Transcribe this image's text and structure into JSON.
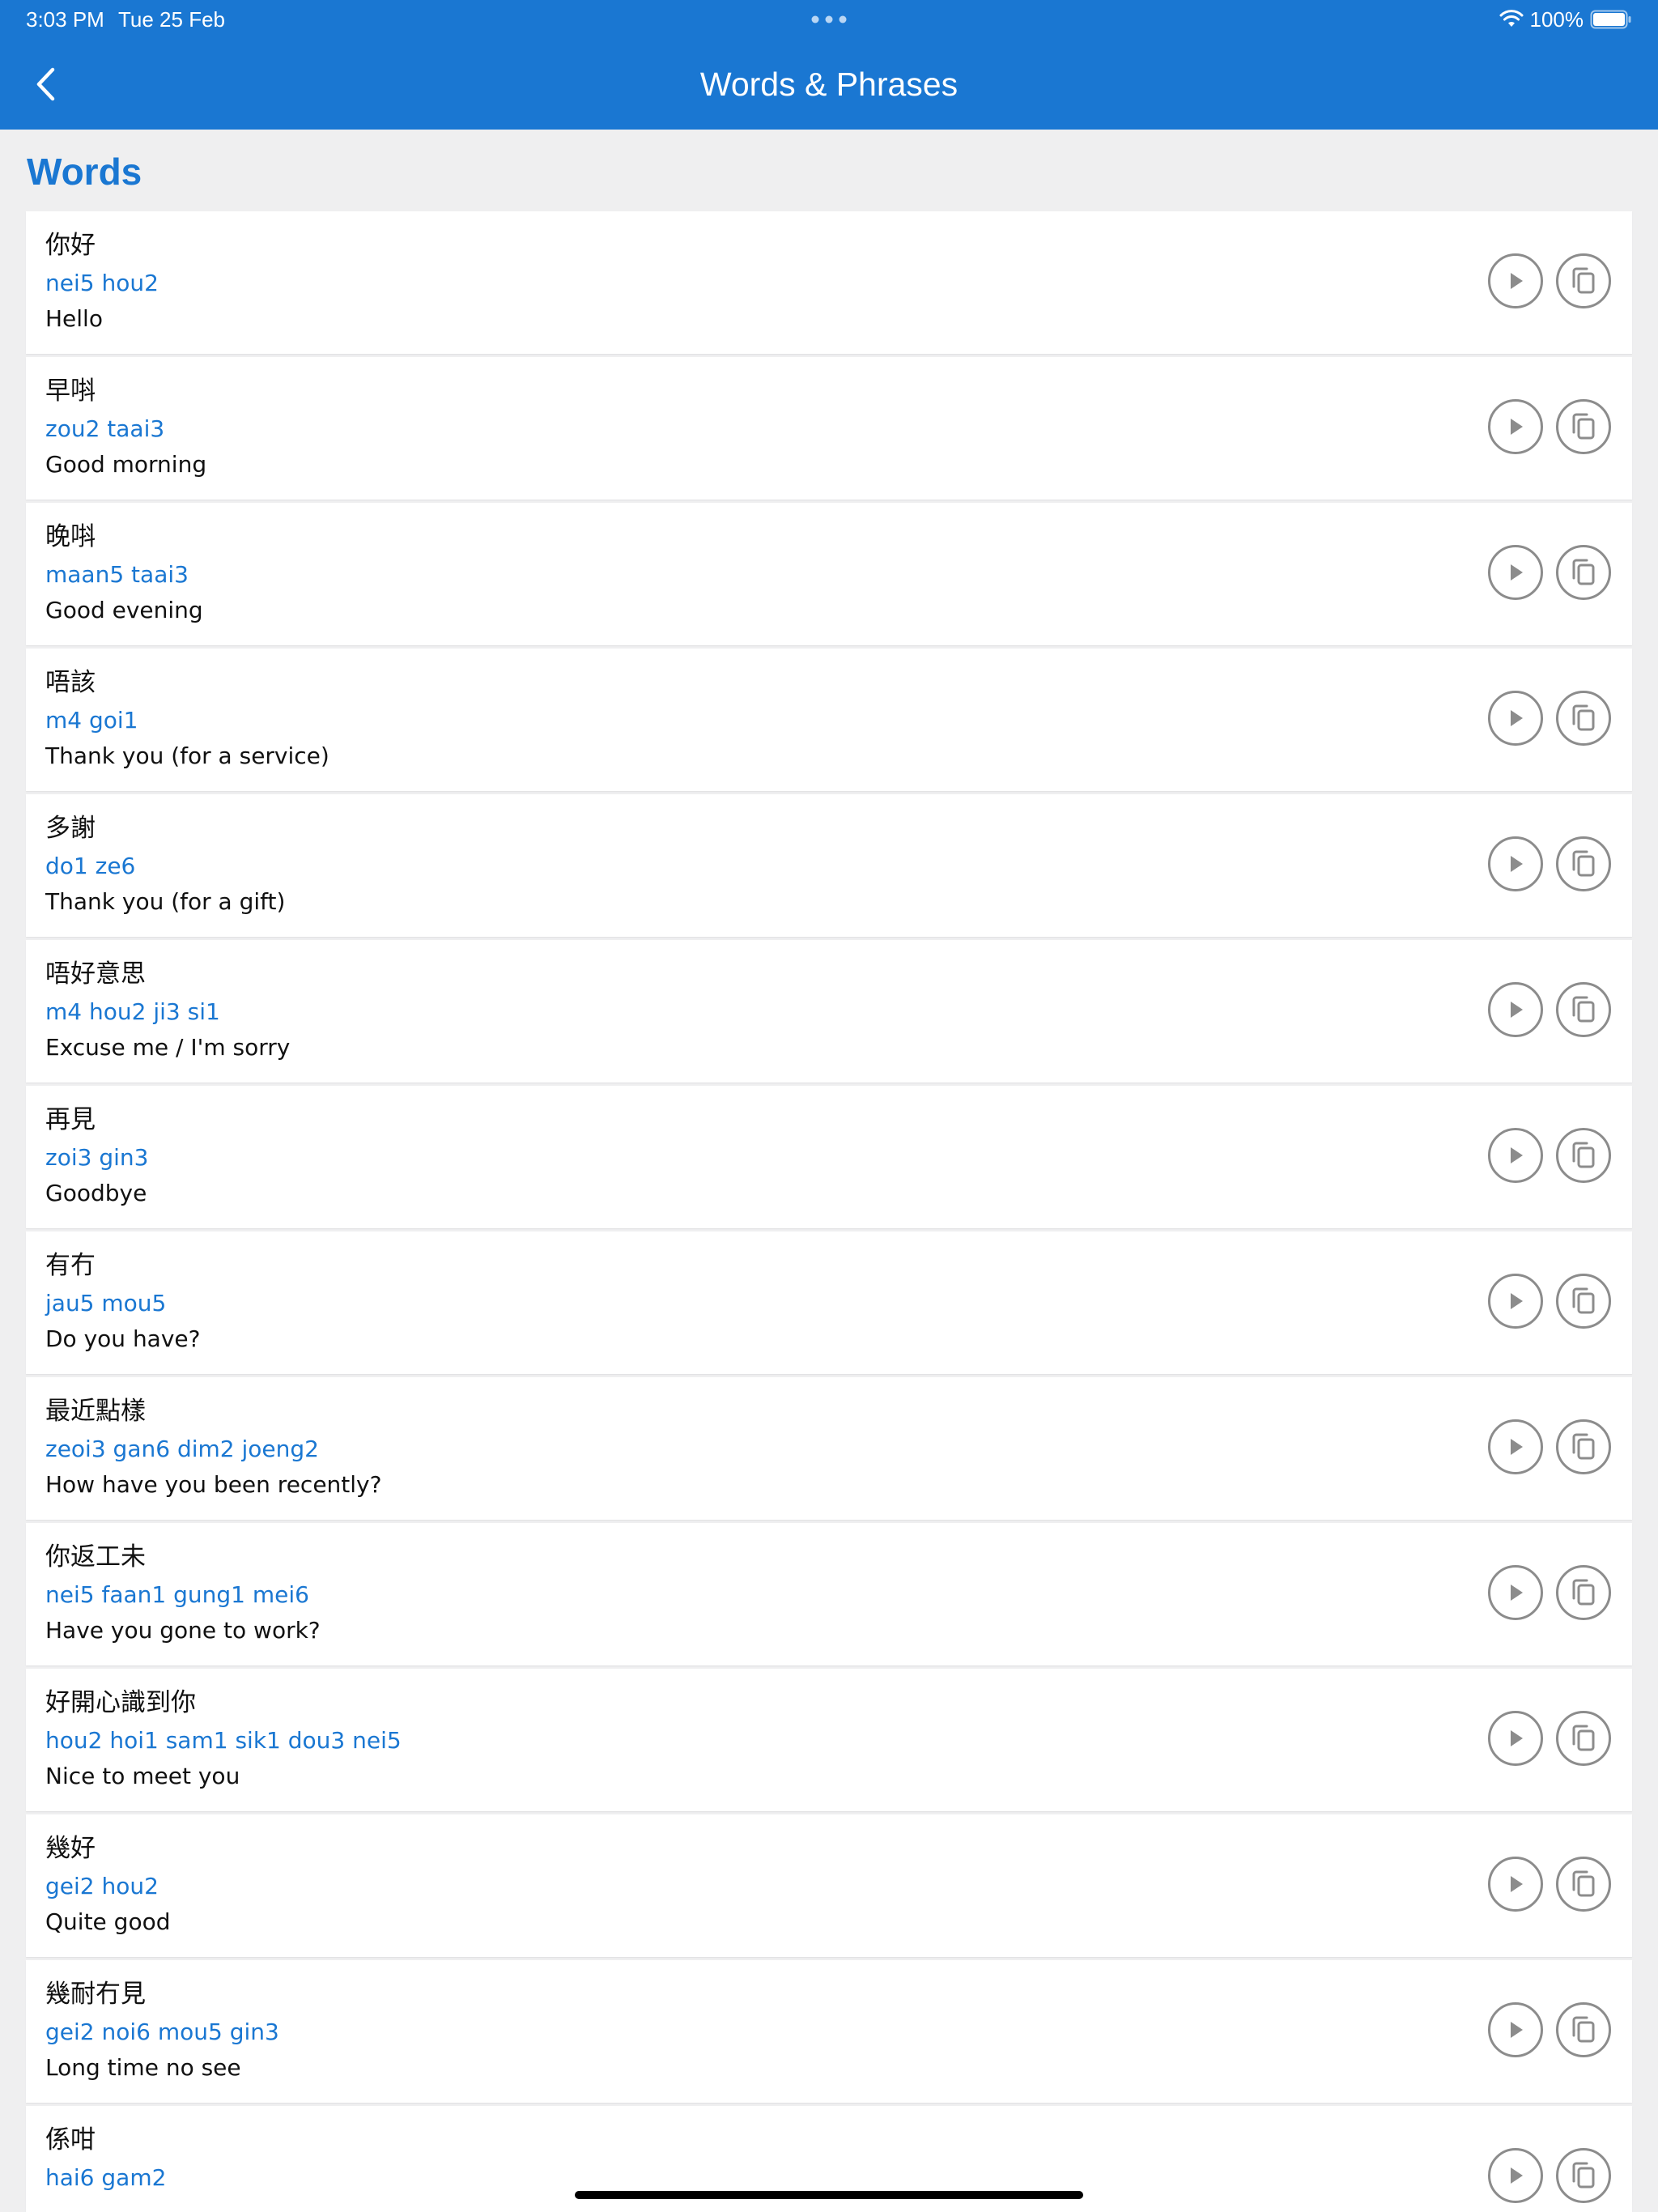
{
  "status_bar": {
    "time": "3:03 PM",
    "date": "Tue 25 Feb",
    "battery": "100%"
  },
  "nav": {
    "title": "Words & Phrases",
    "back_icon": "chevron-left-icon"
  },
  "section": {
    "title": "Words"
  },
  "colors": {
    "accent": "#1a77d2",
    "background": "#efeff0",
    "card": "#ffffff",
    "icon_gray": "#8c8c8c"
  },
  "words": [
    {
      "hanzi": "你好",
      "jyutping": "nei5 hou2",
      "meaning": "Hello"
    },
    {
      "hanzi": "早唞",
      "jyutping": "zou2 taai3",
      "meaning": "Good morning"
    },
    {
      "hanzi": "晚唞",
      "jyutping": "maan5 taai3",
      "meaning": "Good evening"
    },
    {
      "hanzi": "唔該",
      "jyutping": "m4 goi1",
      "meaning": "Thank you (for a service)"
    },
    {
      "hanzi": "多謝",
      "jyutping": "do1 ze6",
      "meaning": "Thank you (for a gift)"
    },
    {
      "hanzi": "唔好意思",
      "jyutping": "m4 hou2 ji3 si1",
      "meaning": "Excuse me / I'm sorry"
    },
    {
      "hanzi": "再見",
      "jyutping": "zoi3 gin3",
      "meaning": "Goodbye"
    },
    {
      "hanzi": "有冇",
      "jyutping": "jau5 mou5",
      "meaning": "Do you have?"
    },
    {
      "hanzi": "最近點樣",
      "jyutping": "zeoi3 gan6 dim2 joeng2",
      "meaning": "How have you been recently?"
    },
    {
      "hanzi": "你返工未",
      "jyutping": "nei5 faan1 gung1 mei6",
      "meaning": "Have you gone to work?"
    },
    {
      "hanzi": "好開心識到你",
      "jyutping": "hou2 hoi1 sam1 sik1 dou3 nei5",
      "meaning": "Nice to meet you"
    },
    {
      "hanzi": "幾好",
      "jyutping": "gei2 hou2",
      "meaning": "Quite good"
    },
    {
      "hanzi": "幾耐冇見",
      "jyutping": "gei2 noi6 mou5 gin3",
      "meaning": "Long time no see"
    },
    {
      "hanzi": "係咁",
      "jyutping": "hai6 gam2",
      "meaning": ""
    }
  ],
  "row_icons": {
    "play": "play-icon",
    "copy": "copy-icon"
  }
}
